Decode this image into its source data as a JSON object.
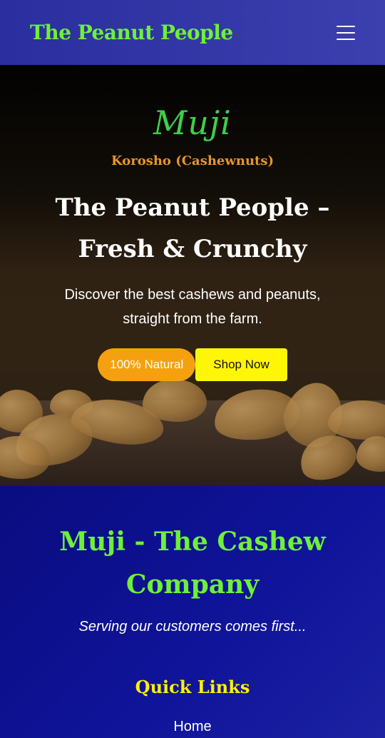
{
  "header": {
    "brand": "The Peanut People",
    "menu_icon": "hamburger-menu-icon"
  },
  "hero": {
    "logo_text": "Muji",
    "subtitle": "Korosho (Cashewnuts)",
    "title": "The Peanut People – Fresh & Crunchy",
    "description": "Discover the best cashews and peanuts, straight from the farm.",
    "badge_label": "100% Natural",
    "cta_label": "Shop Now"
  },
  "about": {
    "title": "Muji - The Cashew Company",
    "tagline": "Serving our customers comes first...",
    "quick_links_title": "Quick Links",
    "links": [
      "Home"
    ]
  },
  "colors": {
    "brand_green": "#6ef03a",
    "accent_orange": "#f5a10f",
    "accent_yellow": "#fff607",
    "navy": "#0c0f7a"
  }
}
